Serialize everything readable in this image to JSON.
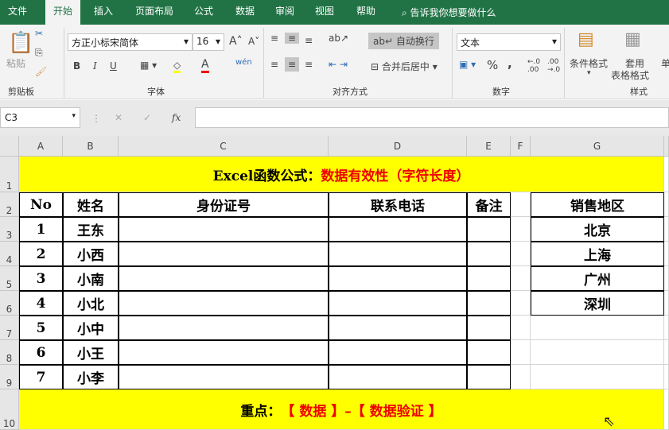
{
  "tabs": [
    "文件",
    "开始",
    "插入",
    "页面布局",
    "公式",
    "数据",
    "审阅",
    "视图",
    "帮助"
  ],
  "tell_me": "告诉我你想要做什么",
  "ribbon": {
    "paste": "粘贴",
    "clipboard": "剪贴板",
    "font_name": "方正小标宋简体",
    "font_size": "16",
    "font_group": "字体",
    "bold": "B",
    "italic": "I",
    "underline": "U",
    "wrap": "自动换行",
    "merge": "合并后居中",
    "align_group": "对齐方式",
    "number_format": "文本",
    "number_group": "数字",
    "percent": "%",
    "comma": ",",
    "cond_format": "条件格式",
    "table_format_1": "套用",
    "table_format_2": "表格格式",
    "styles_group": "样式",
    "cell_more": "单"
  },
  "formula_bar": {
    "name_box": "C3",
    "fx": "fx",
    "formula": ""
  },
  "columns": [
    "A",
    "B",
    "C",
    "D",
    "E",
    "F",
    "G"
  ],
  "rows": [
    "1",
    "2",
    "3",
    "4",
    "5",
    "6",
    "7",
    "8",
    "9",
    "10"
  ],
  "title": {
    "black": "Excel函数公式：",
    "red": "数据有效性（字符长度）"
  },
  "headers": [
    "No",
    "姓名",
    "身份证号",
    "联系电话",
    "备注"
  ],
  "data": [
    [
      "1",
      "王东"
    ],
    [
      "2",
      "小西"
    ],
    [
      "3",
      "小南"
    ],
    [
      "4",
      "小北"
    ],
    [
      "5",
      "小中"
    ],
    [
      "6",
      "小王"
    ],
    [
      "7",
      "小李"
    ]
  ],
  "region": {
    "header": "销售地区",
    "items": [
      "北京",
      "上海",
      "广州",
      "深圳"
    ]
  },
  "footer": {
    "black": "重点：",
    "red": "【 数据 】–【 数据验证 】"
  },
  "colors": {
    "accent": "#217346",
    "highlight": "#ffff00",
    "red": "#e00000"
  }
}
